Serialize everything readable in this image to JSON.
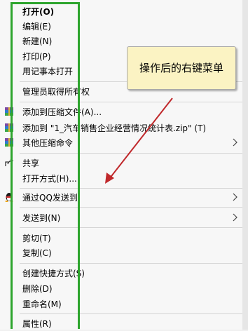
{
  "menu": {
    "items": [
      {
        "label": "打开(O)",
        "bold": true
      },
      {
        "label": "编辑(E)"
      },
      {
        "label": "新建(N)"
      },
      {
        "label": "打印(P)"
      },
      {
        "label": "用记事本打开"
      },
      {
        "label": "管理员取得所有权"
      },
      {
        "label": "添加到压缩文件(A)...",
        "icon": "archive-icon"
      },
      {
        "label": "添加到 \"1_汽车销售企业经营情况统计表.zip\" (T)",
        "icon": "archive-icon"
      },
      {
        "label": "其他压缩命令",
        "icon": "archive-icon",
        "submenu": true
      },
      {
        "label": "共享",
        "icon": "share-icon"
      },
      {
        "label": "打开方式(H)..."
      },
      {
        "label": "通过QQ发送到",
        "icon": "qq-penguin-icon",
        "submenu": true
      },
      {
        "label": "发送到(N)",
        "submenu": true
      },
      {
        "label": "剪切(T)"
      },
      {
        "label": "复制(C)"
      },
      {
        "label": "创建快捷方式(S)"
      },
      {
        "label": "删除(D)"
      },
      {
        "label": "重命名(M)"
      },
      {
        "label": "属性(R)"
      }
    ]
  },
  "callout": {
    "text": "操作后的右键菜单"
  },
  "colors": {
    "highlight_box": "#2ea52e",
    "arrow": "#c0282b",
    "callout_bg": "#fbf3c3"
  }
}
